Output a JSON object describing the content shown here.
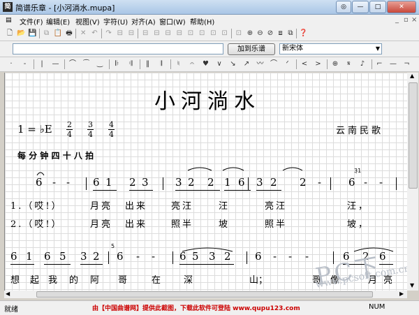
{
  "window": {
    "app_icon": "简",
    "title": "简谱乐章 - [小河淌水.mupa]",
    "controls": [
      "◎",
      "—",
      "□",
      "✕"
    ]
  },
  "menu": [
    "文件(F)",
    "编辑(E)",
    "视图(V)",
    "字符(U)",
    "对齐(A)",
    "窗口(W)",
    "帮助(H)"
  ],
  "toolbar1": [
    {
      "icon": "new-file-icon",
      "glyph": "🗋",
      "dis": false
    },
    {
      "icon": "open-folder-icon",
      "glyph": "📂",
      "dis": false
    },
    {
      "icon": "save-icon",
      "glyph": "💾",
      "dis": false
    },
    {
      "icon": "copy-icon",
      "glyph": "⧉",
      "dis": true
    },
    {
      "icon": "paste-icon",
      "glyph": "📋",
      "dis": true
    },
    {
      "icon": "print-icon",
      "glyph": "🖶",
      "dis": false
    },
    {
      "icon": "cut-icon",
      "glyph": "✕",
      "dis": true
    },
    {
      "icon": "undo-icon",
      "glyph": "↶",
      "dis": true
    },
    {
      "icon": "redo-icon",
      "glyph": "↷",
      "dis": true
    },
    {
      "icon": "align-left-icon",
      "glyph": "⊟",
      "dis": true
    },
    {
      "icon": "align-center-icon",
      "glyph": "⊟",
      "dis": true
    },
    {
      "icon": "align-right-icon",
      "glyph": "⊟",
      "dis": true
    },
    {
      "icon": "align-top-icon",
      "glyph": "⊟",
      "dis": true
    },
    {
      "icon": "align-middle-icon",
      "glyph": "⊟",
      "dis": true
    },
    {
      "icon": "align-bottom-icon",
      "glyph": "⊟",
      "dis": true
    },
    {
      "icon": "distribute-h-icon",
      "glyph": "⊡",
      "dis": true
    },
    {
      "icon": "distribute-v-icon",
      "glyph": "⊡",
      "dis": true
    },
    {
      "icon": "same-width-icon",
      "glyph": "⊡",
      "dis": true
    },
    {
      "icon": "same-height-icon",
      "glyph": "⊡",
      "dis": true
    },
    {
      "icon": "same-size-icon",
      "glyph": "⊡",
      "dis": true
    },
    {
      "icon": "zoom-in-icon",
      "glyph": "⊕",
      "dis": false
    },
    {
      "icon": "zoom-out-icon",
      "glyph": "⊖",
      "dis": false
    },
    {
      "icon": "zoom-reset-icon",
      "glyph": "⊘",
      "dis": false
    },
    {
      "icon": "fit-page-icon",
      "glyph": "⧈",
      "dis": false
    },
    {
      "icon": "full-screen-icon",
      "glyph": "⧉",
      "dis": false
    },
    {
      "icon": "help-icon",
      "glyph": "❓",
      "dis": false
    }
  ],
  "toolbar2": {
    "add_button": "加到乐谱",
    "font_select": "新宋体"
  },
  "toolbar3": [
    "·",
    "-",
    "|",
    "—",
    "⌒",
    "⁀",
    "‿",
    "𝄆",
    "𝄇",
    "‖",
    "𝄂",
    "♮",
    "𝄐",
    "♥",
    "∨",
    "↘",
    "↗",
    "〰",
    "⌒",
    "ᐟ",
    "<",
    ">",
    "⊕",
    "𝄋",
    "♪",
    "⌐",
    "—",
    "¬"
  ],
  "score": {
    "title": "小河淌水",
    "key": "1 = ♭E",
    "time_signatures": [
      [
        "2",
        "4"
      ],
      [
        "3",
        "4"
      ],
      [
        "4",
        "4"
      ]
    ],
    "composer": "云南民歌",
    "tempo": "每 分 钟 四 十 八 拍",
    "line1_notes": [
      "6",
      "-",
      "-",
      "6",
      "1",
      "2",
      "3",
      "3",
      "2",
      "2",
      "1",
      "6",
      "3",
      "2",
      "2",
      "-",
      "6",
      "-",
      "-"
    ],
    "line1_verse1": [
      "1.（哎!）",
      "月亮",
      "出来",
      "亮汪",
      "汪",
      "亮汪",
      "汪，"
    ],
    "line1_verse2": [
      "2.（哎!）",
      "月亮",
      "出来",
      "照半",
      "坡",
      "照半",
      "坡，"
    ],
    "line2_notes": [
      "6",
      "1",
      "6",
      "5",
      "3",
      "2",
      "6",
      "-",
      "-",
      "6",
      "5",
      "3",
      "2",
      "6",
      "-",
      "-",
      "-",
      "6",
      "2",
      "6"
    ],
    "line2_lyrics": [
      "想",
      "起",
      "我",
      "的",
      "阿",
      "哥",
      "在",
      "深",
      "山；",
      "哥",
      "像",
      "月",
      "亮"
    ],
    "grace_notes": [
      "3̣1",
      "5",
      "3"
    ]
  },
  "watermark": {
    "brand": "PC下载网",
    "url": "www.pcsoft.com.cn"
  },
  "status": {
    "left": "就绪",
    "center": "由【中国曲谱网】提供此截图，下载此软件可登陆 www.qupu123.com",
    "right": "NUM"
  },
  "colors": {
    "status_center": "#cc0000",
    "title_bar": "#a9c6e6"
  }
}
